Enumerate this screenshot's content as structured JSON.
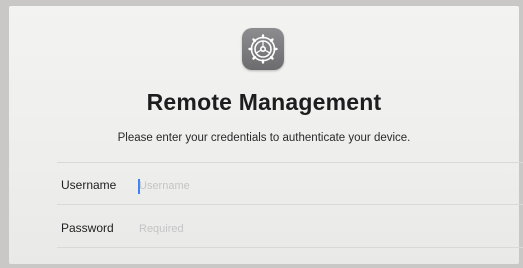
{
  "app": {
    "icon": "settings-gear-icon",
    "title": "Remote Management",
    "subtitle": "Please enter your credentials to authenticate your device."
  },
  "form": {
    "username": {
      "label": "Username",
      "placeholder": "Username",
      "value": ""
    },
    "password": {
      "label": "Password",
      "placeholder": "Required",
      "value": ""
    }
  },
  "colors": {
    "icon_bg": "#7a7a7c",
    "caret": "#3b82f6",
    "background": "#f0f0ee"
  }
}
